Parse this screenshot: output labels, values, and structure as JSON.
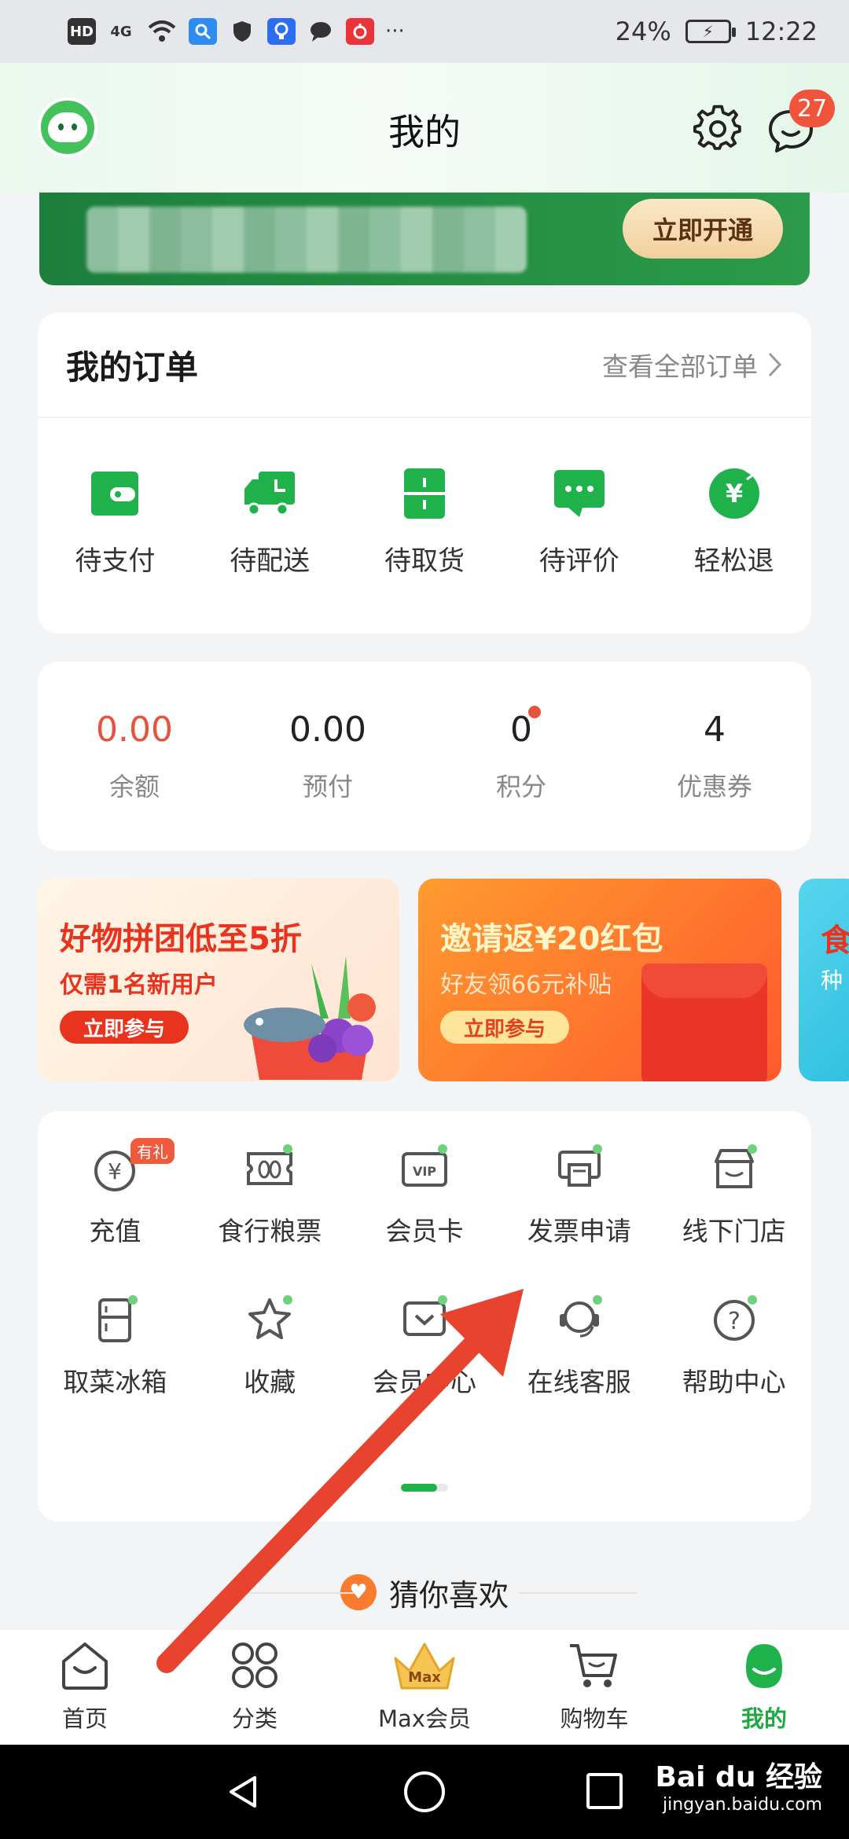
{
  "status_bar": {
    "network": "HD",
    "signal": "4G",
    "battery_pct": "24%",
    "time": "12:22",
    "more": "···"
  },
  "header": {
    "title": "我的",
    "message_badge": "27"
  },
  "member_banner": {
    "button": "立即开通"
  },
  "orders": {
    "title": "我的订单",
    "view_all": "查看全部订单",
    "items": [
      {
        "label": "待支付",
        "icon": "wallet-icon"
      },
      {
        "label": "待配送",
        "icon": "truck-icon"
      },
      {
        "label": "待取货",
        "icon": "box-icon"
      },
      {
        "label": "待评价",
        "icon": "comment-icon"
      },
      {
        "label": "轻松退",
        "icon": "refund-icon"
      }
    ]
  },
  "assets": [
    {
      "value": "0.00",
      "label": "余额"
    },
    {
      "value": "0.00",
      "label": "预付"
    },
    {
      "value": "0",
      "label": "积分"
    },
    {
      "value": "4",
      "label": "优惠券"
    }
  ],
  "promos": [
    {
      "title": "好物拼团低至5折",
      "subtitle": "仅需1名新用户",
      "button": "立即参与"
    },
    {
      "title": "邀请返¥20红包",
      "subtitle": "好友领66元补贴",
      "button": "立即参与"
    },
    {
      "title": "食",
      "subtitle": "种"
    }
  ],
  "services": {
    "gift_tag": "有礼",
    "items": [
      {
        "label": "充值",
        "icon": "yen-coin-icon"
      },
      {
        "label": "食行粮票",
        "icon": "ticket-icon"
      },
      {
        "label": "会员卡",
        "icon": "vip-card-icon"
      },
      {
        "label": "发票申请",
        "icon": "invoice-icon"
      },
      {
        "label": "线下门店",
        "icon": "store-icon"
      },
      {
        "label": "取菜冰箱",
        "icon": "fridge-icon"
      },
      {
        "label": "收藏",
        "icon": "star-icon"
      },
      {
        "label": "会员中心",
        "icon": "member-center-icon"
      },
      {
        "label": "在线客服",
        "icon": "headset-icon"
      },
      {
        "label": "帮助中心",
        "icon": "help-icon"
      }
    ]
  },
  "guess": {
    "title": "猜你喜欢"
  },
  "bottom_nav": [
    {
      "label": "首页",
      "icon": "home-icon"
    },
    {
      "label": "分类",
      "icon": "category-icon"
    },
    {
      "label": "Max会员",
      "icon": "crown-icon",
      "crown_text": "Max"
    },
    {
      "label": "购物车",
      "icon": "cart-icon"
    },
    {
      "label": "我的",
      "icon": "profile-icon",
      "active": true
    }
  ],
  "watermark": {
    "text": "Bai du 经验",
    "url": "jingyan.baidu.com"
  },
  "colors": {
    "brand_green": "#1fb24a",
    "accent_red": "#e7533b",
    "annotation_arrow": "#e8432f"
  }
}
